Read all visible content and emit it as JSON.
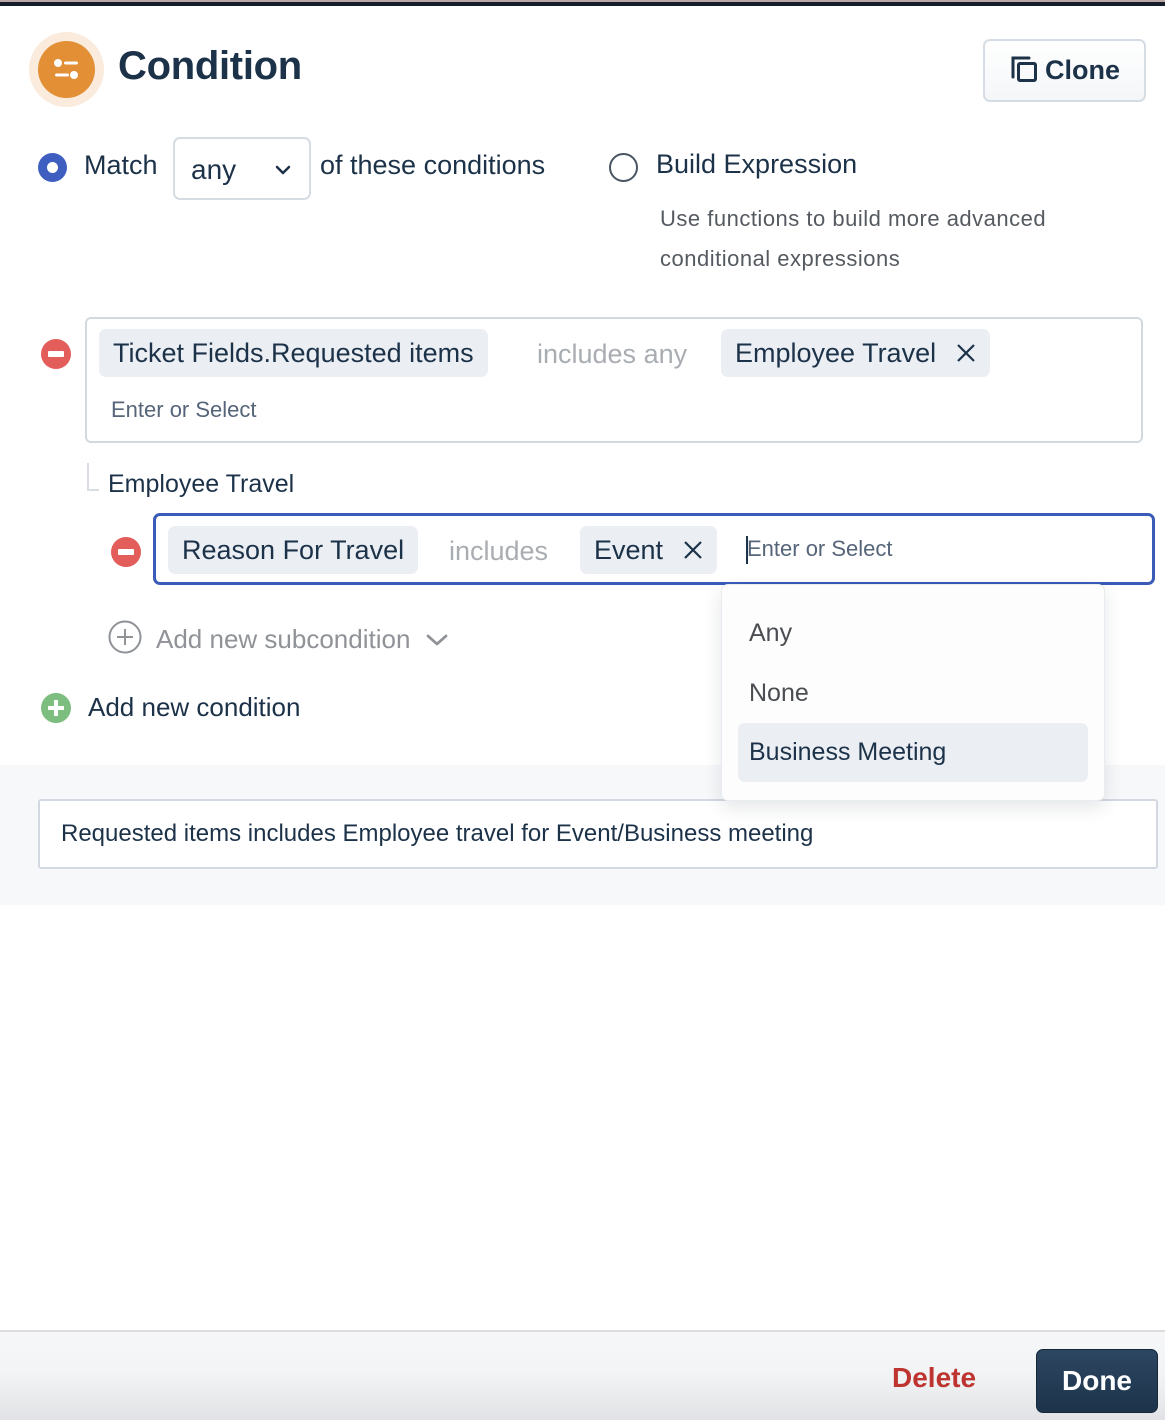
{
  "header": {
    "title": "Condition",
    "icon": "sliders-icon",
    "clone_label": "Clone",
    "clone_icon": "copy-icon"
  },
  "match": {
    "selected_mode": "match",
    "match_label": "Match",
    "match_value": "any",
    "match_suffix": "of these conditions",
    "expression_label": "Build Expression",
    "expression_description": "Use functions to build more advanced conditional expressions"
  },
  "conditions": [
    {
      "field": "Ticket Fields.Requested items",
      "operator": "includes any",
      "values": [
        "Employee Travel"
      ],
      "input_placeholder": "Enter or Select",
      "subcondition_group": {
        "title": "Employee Travel",
        "subconditions": [
          {
            "field": "Reason For Travel",
            "operator": "includes",
            "values": [
              "Event"
            ],
            "input_placeholder": "Enter or Select",
            "focused": true
          }
        ],
        "add_subcondition_label": "Add new subcondition"
      }
    }
  ],
  "add_condition_label": "Add new condition",
  "dropdown": {
    "options": [
      "Any",
      "None",
      "Business Meeting"
    ],
    "highlighted": "Business Meeting"
  },
  "description": {
    "value": "Requested items includes Employee travel for Event/Business meeting"
  },
  "footer": {
    "delete_label": "Delete",
    "done_label": "Done"
  },
  "colors": {
    "accent": "#3e5fbf",
    "header_icon": "#e28f35",
    "remove": "#e35d5a",
    "add": "#7dbd80",
    "delete": "#bd3430",
    "primary_button": "#1d334b"
  }
}
